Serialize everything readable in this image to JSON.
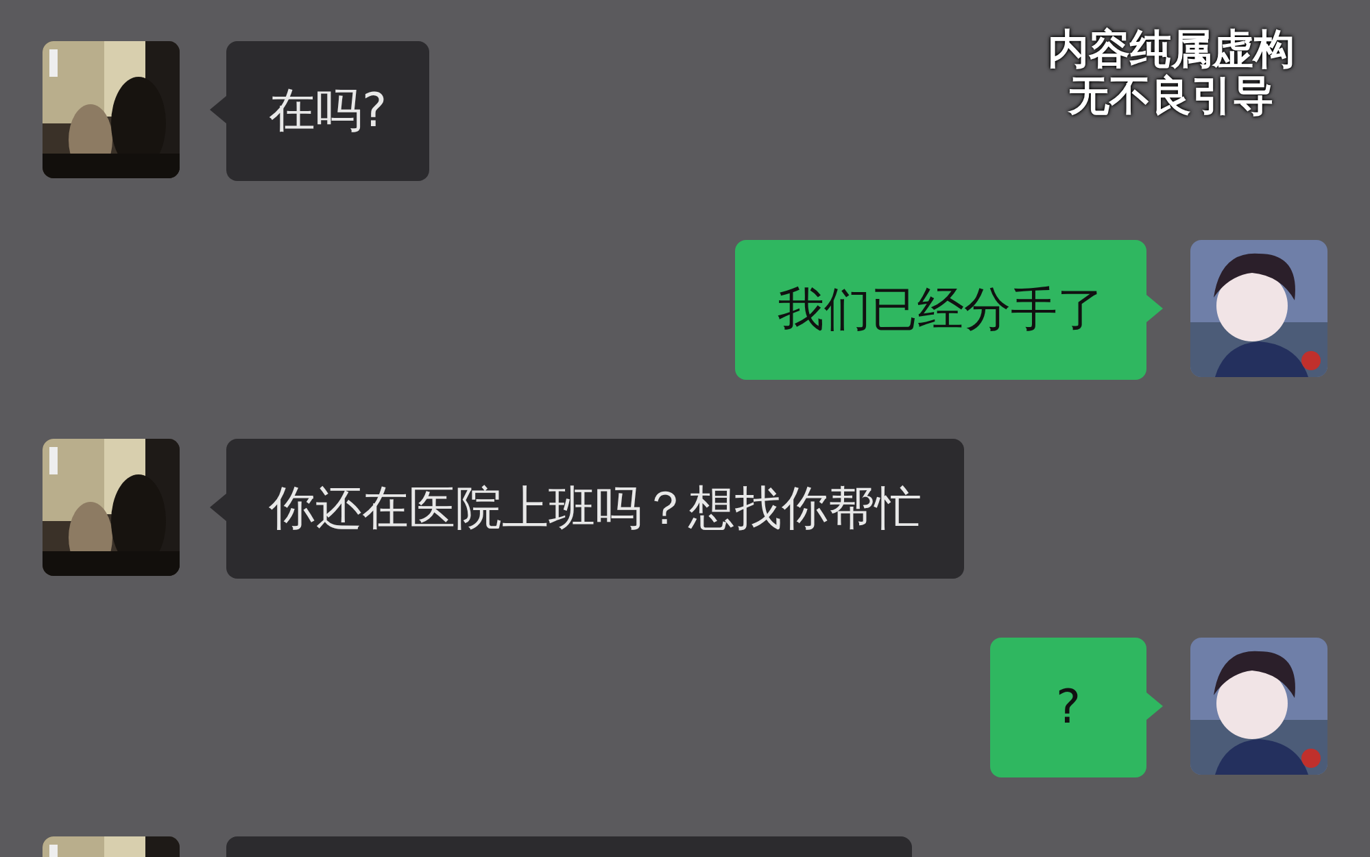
{
  "caption": {
    "lines": [
      "内容纯属虚构",
      "无不良引导"
    ]
  },
  "messages": [
    {
      "kind": "incoming",
      "text": "在吗?"
    },
    {
      "kind": "outgoing",
      "text": "我们已经分手了"
    },
    {
      "kind": "incoming",
      "text": "你还在医院上班吗？想找你帮忙"
    },
    {
      "kind": "outgoing",
      "text": "?"
    },
    {
      "kind": "incoming"
    }
  ]
}
